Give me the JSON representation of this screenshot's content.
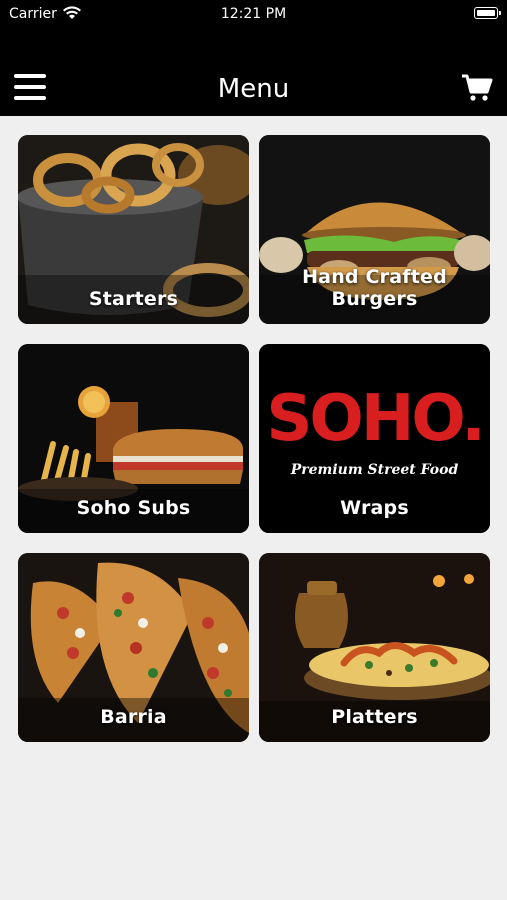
{
  "status_bar": {
    "carrier": "Carrier",
    "time": "12:21 PM",
    "wifi_icon": "wifi-icon",
    "battery_icon": "battery-icon"
  },
  "navbar": {
    "title": "Menu",
    "menu_icon": "hamburger-menu-icon",
    "cart_icon": "shopping-cart-icon",
    "background": "#000000"
  },
  "categories": [
    {
      "label": "Starters"
    },
    {
      "label": "Hand Crafted Burgers"
    },
    {
      "label": "Soho Subs"
    },
    {
      "label": "Wraps"
    },
    {
      "label": "Barria"
    },
    {
      "label": "Platters"
    }
  ],
  "wraps_logo": {
    "brand": "SOHO.",
    "tagline": "Premium Street Food",
    "brand_color": "#d81e1e"
  },
  "page_background": "#efefef"
}
